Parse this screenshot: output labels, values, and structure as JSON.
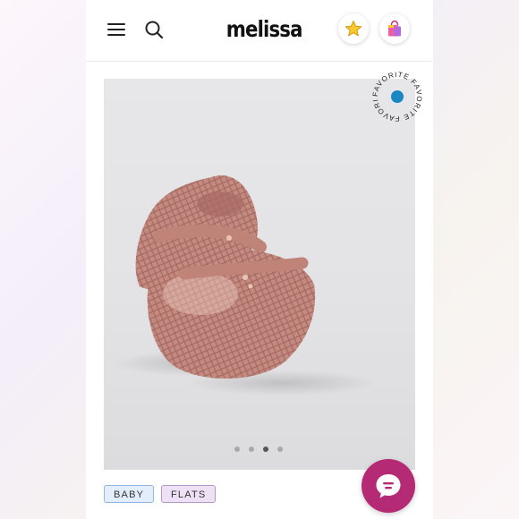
{
  "header": {
    "logo_text": "melissa",
    "icons": {
      "menu": "hamburger-menu-icon",
      "search": "search-icon",
      "favorites": "star-icon",
      "bag": "shopping-bag-icon"
    }
  },
  "product": {
    "image_subject": "glitter-pink-caged-jelly-mary-jane-flats",
    "favorite_badge": {
      "text": "FAVORITE FAVORITE FAVORITE",
      "dot_color": "#1a86c4"
    },
    "carousel": {
      "total": 4,
      "active_index": 3
    },
    "tags": [
      {
        "label": "BABY"
      },
      {
        "label": "FLATS"
      }
    ]
  },
  "chat": {
    "icon": "chat-bubble-icon",
    "color": "#b52a74"
  },
  "colors": {
    "shoe": "#c48a80",
    "tag_baby_bg": "#e2eefc",
    "tag_flats_bg": "#efe1f5"
  }
}
